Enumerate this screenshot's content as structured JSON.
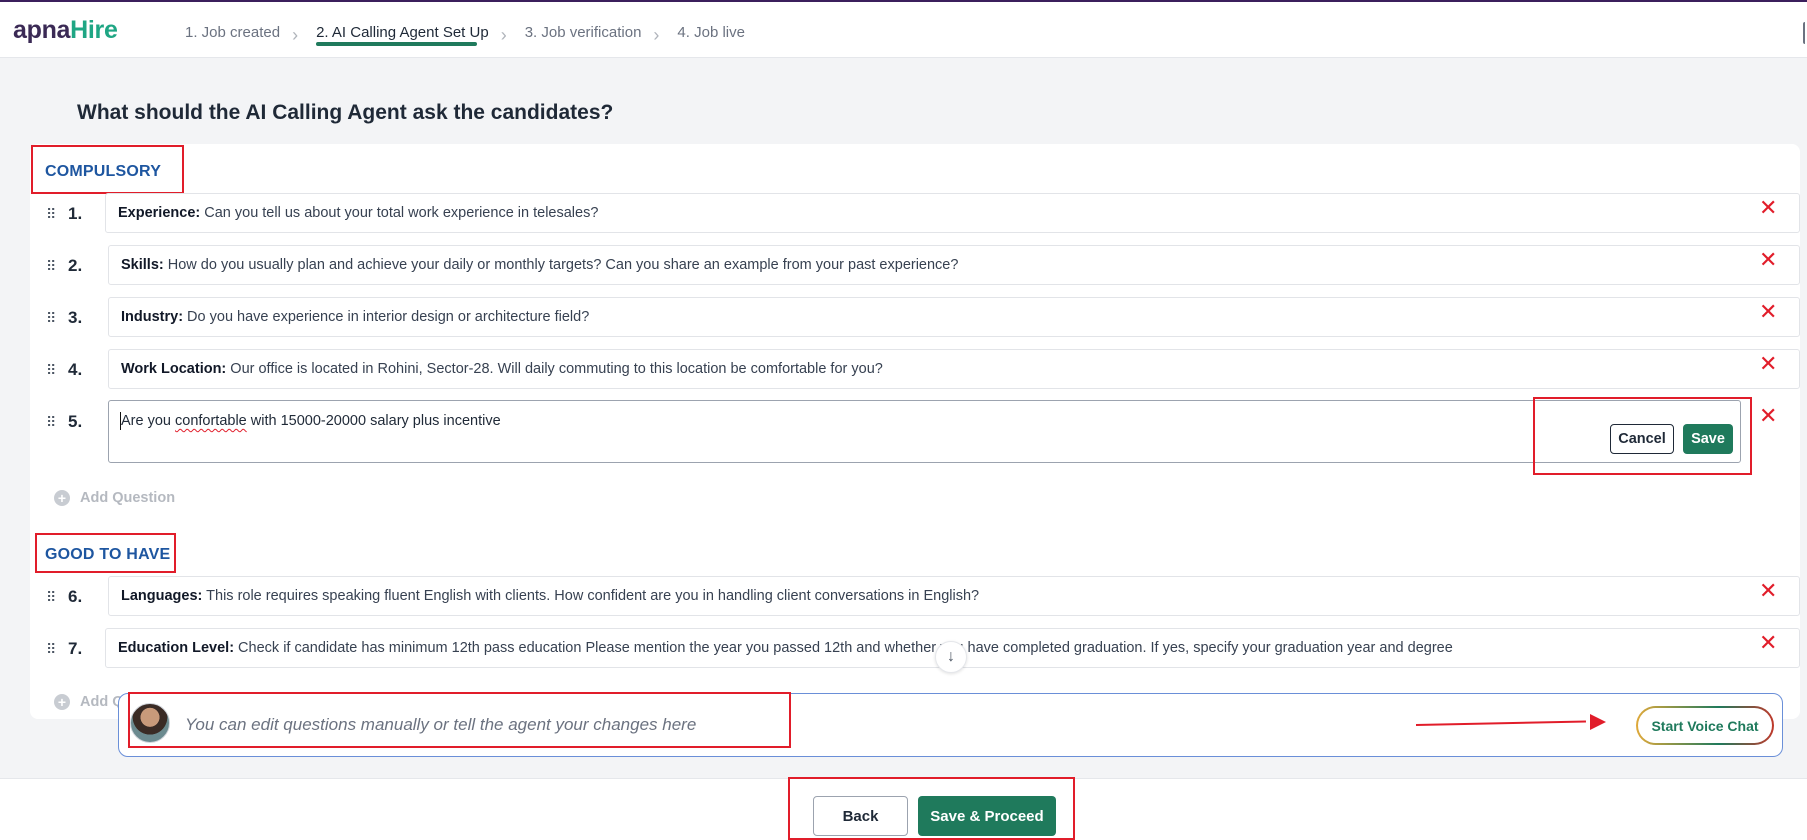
{
  "brand": {
    "part1": "apna",
    "part2": "Hire"
  },
  "steps": [
    {
      "label": "1. Job created"
    },
    {
      "label": "2. AI Calling Agent Set Up"
    },
    {
      "label": "3. Job verification"
    },
    {
      "label": "4. Job live"
    }
  ],
  "heading": "What should the AI Calling Agent ask the candidates?",
  "sections": {
    "compulsory": "COMPULSORY",
    "good_to_have": "GOOD TO HAVE"
  },
  "questions": [
    {
      "num": "1.",
      "key": "Experience:",
      "text": " Can you tell us about your total work experience in telesales?"
    },
    {
      "num": "2.",
      "key": "Skills:",
      "text": " How do you usually plan and achieve your daily or monthly targets? Can you share an example from your past experience?"
    },
    {
      "num": "3.",
      "key": "Industry:",
      "text": " Do you have experience in interior design or architecture field?"
    },
    {
      "num": "4.",
      "key": "Work Location:",
      "text": " Our office is located in Rohini, Sector-28. Will daily commuting to this location be comfortable for you?"
    },
    {
      "num": "5.",
      "edit_pre": "Are you ",
      "edit_misspelled": "confortable",
      "edit_post": " with 15000-20000 salary plus incentive"
    },
    {
      "num": "6.",
      "key": "Languages:",
      "text": " This role requires speaking fluent English with clients. How confident are you in handling client conversations in English?"
    },
    {
      "num": "7.",
      "key": "Education Level:",
      "text": " Check if candidate has minimum 12th pass education Please mention the year you passed 12th and whether you have completed graduation. If yes, specify your graduation year and degree"
    }
  ],
  "edit_actions": {
    "cancel": "Cancel",
    "save": "Save"
  },
  "add_question": "Add Question",
  "add_question_truncated": "Add Q",
  "chat": {
    "placeholder": "You can edit questions manually or tell the agent your changes here",
    "voice_button": "Start Voice Chat"
  },
  "footer": {
    "back": "Back",
    "proceed": "Save & Proceed"
  },
  "icons": {
    "drag": "⠿",
    "close": "✕",
    "chevron": "›",
    "plus": "+",
    "arrow_down": "↓"
  },
  "colors": {
    "brand_dark": "#3b2a55",
    "brand_green": "#1fa684",
    "primary": "#1f7a5c",
    "section_blue": "#1e56a0",
    "annotation_red": "#e11d2a"
  }
}
